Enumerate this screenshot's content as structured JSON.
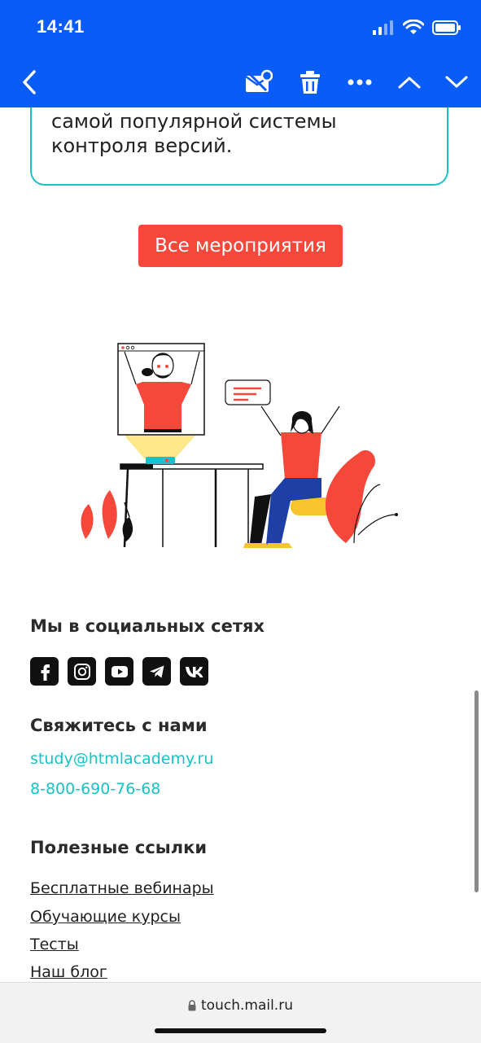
{
  "status_bar": {
    "time": "14:41"
  },
  "toolbar": {
    "back_icon": "chevron-left-icon",
    "actions": [
      "mark-unread-icon",
      "trash-icon",
      "more-icon",
      "chevron-up-icon",
      "chevron-down-icon"
    ]
  },
  "event_card": {
    "text": "самой популярной системы контроля версий."
  },
  "all_events_button": "Все мероприятия",
  "social": {
    "title": "Мы в социальных сетях",
    "icons": [
      "facebook-icon",
      "instagram-icon",
      "youtube-icon",
      "telegram-icon",
      "vk-icon"
    ]
  },
  "contact": {
    "title": "Свяжитесь с нами",
    "email": "study@htmlacademy.ru",
    "phone": "8-800-690-76-68"
  },
  "useful_links": {
    "title": "Полезные ссылки",
    "items": [
      "Бесплатные вебинары",
      "Обучающие курсы",
      "Тесты",
      "Наш блог"
    ]
  },
  "address_bar": {
    "url": "touch.mail.ru"
  },
  "colors": {
    "brand_blue": "#0a5cf6",
    "accent_red": "#f6483a",
    "accent_teal": "#1ac1c6"
  }
}
